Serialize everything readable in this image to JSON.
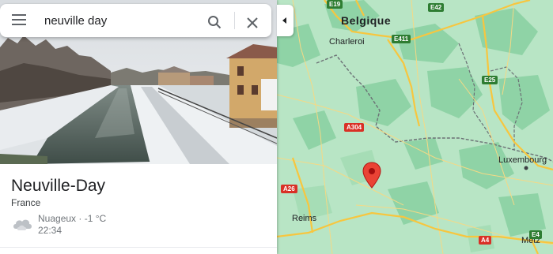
{
  "search": {
    "query": "neuville day",
    "menu_icon": "hamburger-icon",
    "search_icon": "magnifier-icon",
    "close_icon": "x-icon"
  },
  "place": {
    "name": "Neuville-Day",
    "country": "France",
    "weather": {
      "description": "Nuageux · -1 °C",
      "time": "22:34",
      "icon": "cloud-icon"
    }
  },
  "map": {
    "countries": [
      "Belgique"
    ],
    "cities": [
      "Charleroi",
      "Luxembourg",
      "Reims",
      "Metz"
    ],
    "roads": {
      "european": [
        "E19",
        "E42",
        "E411",
        "E25",
        "E4"
      ],
      "national": [
        "A304",
        "A26",
        "A4"
      ]
    },
    "colors": {
      "land": "#b8e5c5",
      "forest": "#8fd3a6",
      "highway": "#f7c63f",
      "border": "#5f6368",
      "pin": "#ea4335"
    }
  }
}
